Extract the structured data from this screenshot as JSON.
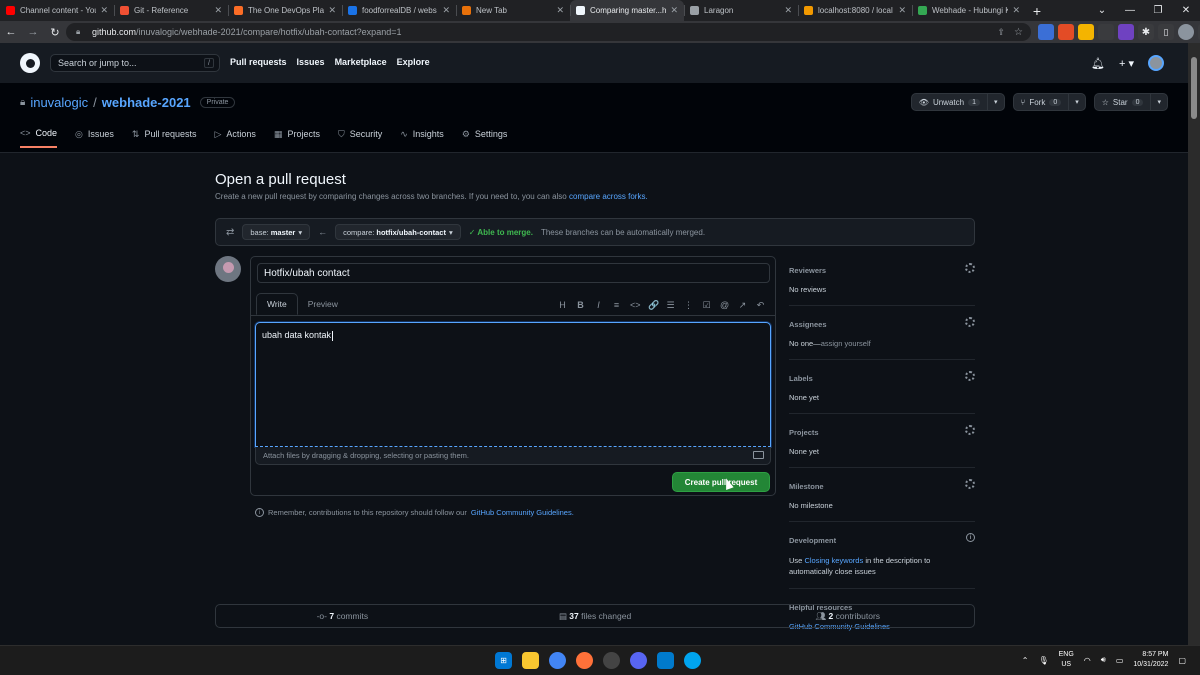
{
  "browser": {
    "tabs": [
      {
        "title": "Channel content - You",
        "color": "#ff0000",
        "active": false
      },
      {
        "title": "Git - Reference",
        "color": "#f05033",
        "active": false
      },
      {
        "title": "The One DevOps Platf",
        "color": "#fc6d26",
        "active": false
      },
      {
        "title": "foodforrealDB / webs",
        "color": "#1a73e8",
        "active": false
      },
      {
        "title": "New Tab",
        "color": "#e8710a",
        "active": false
      },
      {
        "title": "Comparing master...h",
        "color": "#f0f6fc",
        "active": true
      },
      {
        "title": "Laragon",
        "color": "#9aa0a6",
        "active": false
      },
      {
        "title": "localhost:8080 / local",
        "color": "#f29900",
        "active": false
      },
      {
        "title": "Webhade - Hubungi K",
        "color": "#34a853",
        "active": false
      }
    ],
    "new_tab": "+",
    "url_host": "github.com",
    "url_path": "/inuvalogic/webhade-2021/compare/hotfix/ubah-contact?expand=1"
  },
  "github": {
    "search_placeholder": "Search or jump to...",
    "search_key": "/",
    "nav": [
      "Pull requests",
      "Issues",
      "Marketplace",
      "Explore"
    ]
  },
  "repo": {
    "owner": "inuvalogic",
    "separator": "/",
    "name": "webhade-2021",
    "visibility": "Private",
    "watch_label": "Unwatch",
    "watch_count": "1",
    "fork_label": "Fork",
    "fork_count": "0",
    "star_label": "Star",
    "star_count": "0",
    "tabs": [
      {
        "label": "Code",
        "icon": "<>"
      },
      {
        "label": "Issues",
        "icon": "◎"
      },
      {
        "label": "Pull requests",
        "icon": "⇅"
      },
      {
        "label": "Actions",
        "icon": "▷"
      },
      {
        "label": "Projects",
        "icon": "▦"
      },
      {
        "label": "Security",
        "icon": "⛉"
      },
      {
        "label": "Insights",
        "icon": "∿"
      },
      {
        "label": "Settings",
        "icon": "⚙"
      }
    ]
  },
  "compare": {
    "heading": "Open a pull request",
    "subtitle": "Create a new pull request by comparing changes across two branches. If you need to, you can also",
    "subtitle_link": "compare across forks.",
    "base_prefix": "base:",
    "base_branch": "master",
    "compare_prefix": "compare:",
    "compare_branch": "hotfix/ubah-contact",
    "merge_status": "✓ Able to merge.",
    "merge_message": "These branches can be automatically merged."
  },
  "form": {
    "title_value": "Hotfix/ubah contact",
    "tab_write": "Write",
    "tab_preview": "Preview",
    "toolbar": [
      "H",
      "B",
      "I",
      "≡",
      "<>",
      "🔗",
      "☰",
      "⋮",
      "☑",
      "@",
      "↗",
      "↶"
    ],
    "body_value": "ubah data kontak",
    "attach_hint": "Attach files by dragging & dropping, selecting or pasting them.",
    "submit_label": "Create pull request",
    "remember_text": "Remember, contributions to this repository should follow our",
    "remember_link": "GitHub Community Guidelines."
  },
  "sidebar": {
    "reviewers_title": "Reviewers",
    "reviewers_value": "No reviews",
    "assignees_title": "Assignees",
    "assignees_value": "No one—",
    "assignees_link": "assign yourself",
    "labels_title": "Labels",
    "labels_value": "None yet",
    "projects_title": "Projects",
    "projects_value": "None yet",
    "milestone_title": "Milestone",
    "milestone_value": "No milestone",
    "development_title": "Development",
    "development_pre": "Use",
    "development_link": "Closing keywords",
    "development_post": "in the description to automatically close issues",
    "resources_title": "Helpful resources",
    "resources_link": "GitHub Community Guidelines"
  },
  "stats": {
    "commits_count": "7",
    "commits_label": "commits",
    "files_count": "37",
    "files_label": "files changed",
    "contributors_count": "2",
    "contributors_label": "contributors"
  },
  "taskbar": {
    "lang_top": "ENG",
    "lang_bottom": "US",
    "time": "8:57 PM",
    "date": "10/31/2022"
  }
}
